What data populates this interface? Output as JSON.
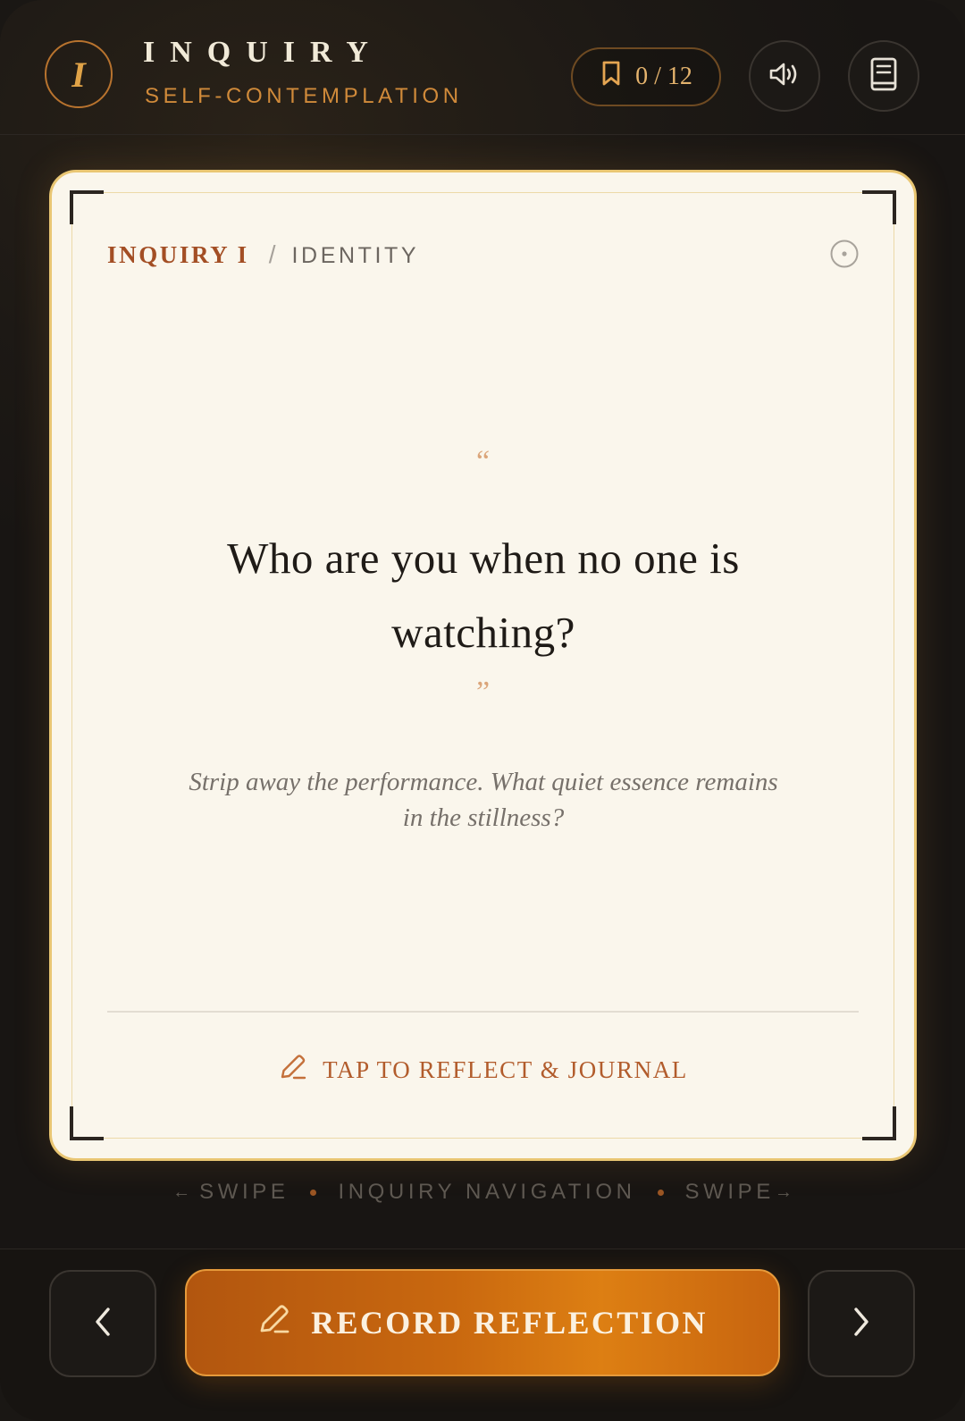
{
  "header": {
    "logo_letter": "I",
    "title": "INQUIRY",
    "subtitle": "SELF-CONTEMPLATION",
    "saved_counter": "0 / 12",
    "icons": {
      "bookmark": "bookmark-icon",
      "sound": "speaker-icon",
      "journal": "journal-icon"
    }
  },
  "card": {
    "breadcrumb_main": "INQUIRY I",
    "breadcrumb_separator": "/",
    "breadcrumb_sub": "IDENTITY",
    "quote_open": "“",
    "question": "Who are you when no one is watching?",
    "quote_close": "”",
    "subtext": "Strip away the performance. What quiet essence remains in the stillness?",
    "reflect_link": "TAP TO REFLECT & JOURNAL"
  },
  "swipe_hint": {
    "left_arrow": "←",
    "left": "SWIPE",
    "center": "INQUIRY NAVIGATION",
    "right": "SWIPE",
    "right_arrow": "→"
  },
  "footer": {
    "record_label": "RECORD REFLECTION"
  },
  "colors": {
    "accent": "#d08a3a",
    "card_bg": "#faf6ec",
    "card_border": "#e9c673",
    "primary_button": "#c9680f",
    "breadcrumb": "#a34e24"
  }
}
